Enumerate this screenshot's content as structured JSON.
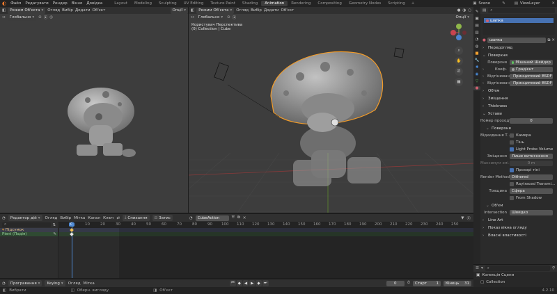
{
  "topbar": {
    "menus": [
      "Файл",
      "Редагувати",
      "Рендер",
      "Вікно",
      "Довідка"
    ],
    "workspaces": [
      "Layout",
      "Modeling",
      "Sculpting",
      "UV Editing",
      "Texture Paint",
      "Shading",
      "Animation",
      "Rendering",
      "Compositing",
      "Geometry Nodes",
      "Scripting"
    ],
    "active_workspace": "Animation",
    "add_tab": "+",
    "scene": "Scene",
    "view_layer": "ViewLayer"
  },
  "left_viewport": {
    "mode": "Режим Об'єкта",
    "menus": [
      "Огляд",
      "Вибір",
      "Додати",
      "Об'єкт"
    ],
    "transform": "Глобально",
    "options": "Опції"
  },
  "main_viewport": {
    "mode": "Режим Об'єкта",
    "menus": [
      "Огляд",
      "Вибір",
      "Додати",
      "Об'єкт"
    ],
    "transform": "Глобально",
    "options": "Опції",
    "view_name": "Користувач Перспектива",
    "collection_info": "(0) Collection | Cube"
  },
  "properties": {
    "search_placeholder": "",
    "material_slot": "шапка",
    "material_name": "шапка",
    "sections": {
      "preview": "Передогляд",
      "surface": "Поверхня",
      "volume": "Об'єм",
      "displacement": "Зміщення",
      "thickness": "Thickness",
      "settings": "Устави",
      "surface_sub": "Поверхня",
      "volume_sub": "Об'єм",
      "line_art": "Line Art",
      "viewport_display": "Показ вікна огляду",
      "custom_props": "Власні властивості"
    },
    "surface_label": "Поверхня",
    "surface_value": "Мішаний Шейдер",
    "fac_label": "Коеф.",
    "fac_value": "Градієнт",
    "shader1_label": "Відтінювач",
    "shader1_value": "Принциповий BSDF",
    "shader2_label": "Відтінювач",
    "shader2_value": "Принциповий BSDF",
    "pass_index_label": "Номер проходу",
    "pass_index_value": "0",
    "backface_label": "Відкидання Т...",
    "camera_label": "Камера",
    "shadow_label": "Тінь",
    "light_probe_label": "Light Probe Volume",
    "displacement_label": "Зміщення",
    "displacement_value": "Лише витиснення",
    "max_displacement_label": "Максимум змі...",
    "max_displacement_value": "0 m",
    "transparent_shadows_label": "Прозорі тіні",
    "render_method_label": "Render Method",
    "render_method_value": "Dithered",
    "raytraced_label": "Raytraced Transmi...",
    "thickness_label": "Товщина",
    "thickness_value": "Сфера",
    "from_shadow_label": "From Shadow",
    "intersection_label": "Intersection",
    "intersection_value": "Швидко"
  },
  "outliner": {
    "search_placeholder": "",
    "scene_collection": "Колекція Сцени",
    "collection": "Collection"
  },
  "dopesheet": {
    "editor": "Редактор дій",
    "menus": [
      "Огляд",
      "Вибір",
      "Мітка",
      "Канал",
      "Ключ"
    ],
    "push_down": "Спихання",
    "stash": "Затис",
    "action": "CubeAction",
    "current_frame": "0",
    "ruler": [
      "0",
      "10",
      "20",
      "30",
      "40",
      "50",
      "60",
      "70",
      "80",
      "90",
      "100",
      "110",
      "120",
      "130",
      "140",
      "150",
      "160",
      "170",
      "180",
      "190",
      "200",
      "210",
      "220",
      "230",
      "240",
      "250"
    ],
    "tracks": [
      "Підсумок",
      "Рівні (Подія)"
    ]
  },
  "timeline": {
    "playback": "Програвання",
    "keying": "Keying",
    "view": "Огляд",
    "marker": "Мітка",
    "frame": "0",
    "start_label": "Старт",
    "start_value": "1",
    "end_label": "Кінець",
    "end_value": "31"
  },
  "statusbar": {
    "select": "Вибрати",
    "rotate_view": "Оберн. вигляду",
    "object": "Об'єкт",
    "version": "4.2.10"
  },
  "colors": {
    "accent": "#4772b3",
    "selection_outline": "#f29b28",
    "header": "#303030",
    "viewport_bg": "#3d3d3d",
    "editor_bg": "#2b2b2b",
    "playhead": "#4f8bd6"
  }
}
